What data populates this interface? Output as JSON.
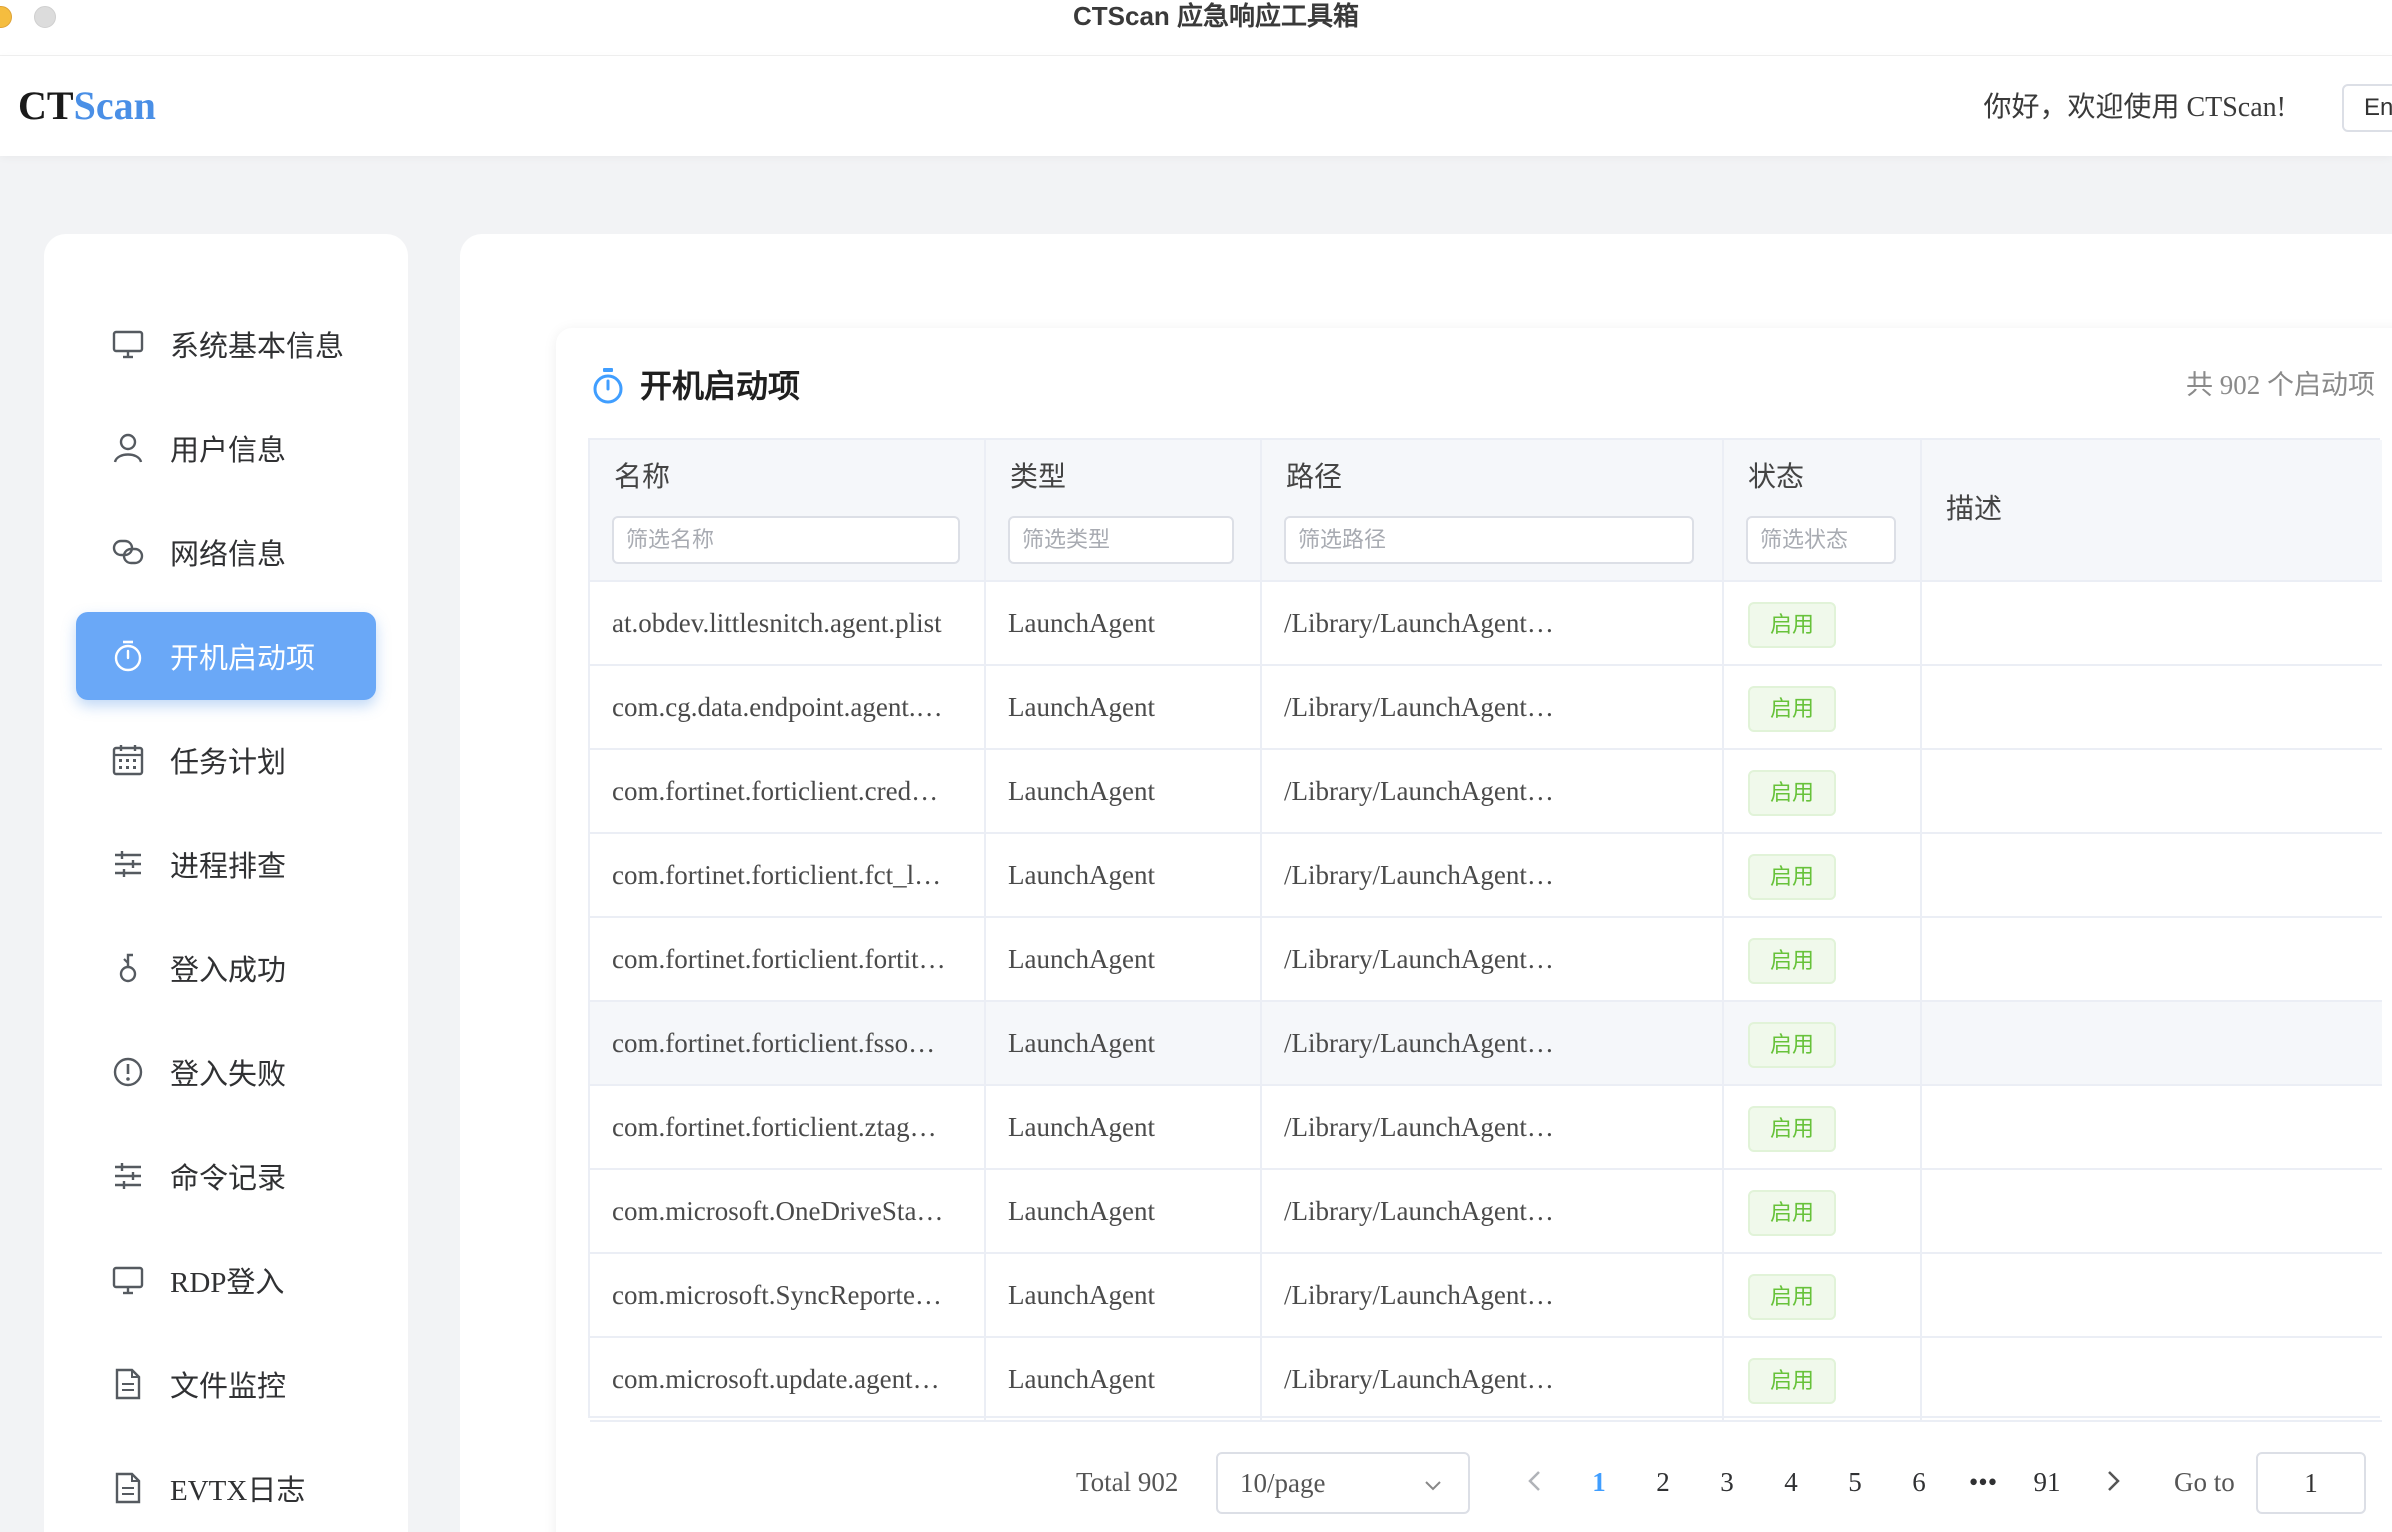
{
  "window": {
    "title": "CTScan 应急响应工具箱"
  },
  "header": {
    "logo_ct": "CT",
    "logo_scan": "Scan",
    "greeting": "你好，欢迎使用 CTScan!",
    "lang_button": "En"
  },
  "sidebar": {
    "items": [
      {
        "label": "系统基本信息",
        "icon": "monitor-icon"
      },
      {
        "label": "用户信息",
        "icon": "user-icon"
      },
      {
        "label": "网络信息",
        "icon": "link-icon"
      },
      {
        "label": "开机启动项",
        "icon": "timer-icon",
        "active": true
      },
      {
        "label": "任务计划",
        "icon": "calendar-icon"
      },
      {
        "label": "进程排查",
        "icon": "sliders-icon"
      },
      {
        "label": "登入成功",
        "icon": "key-icon"
      },
      {
        "label": "登入失败",
        "icon": "warning-icon"
      },
      {
        "label": "命令记录",
        "icon": "sliders-icon"
      },
      {
        "label": "RDP登入",
        "icon": "monitor-icon"
      },
      {
        "label": "文件监控",
        "icon": "document-icon"
      },
      {
        "label": "EVTX日志",
        "icon": "document-icon"
      }
    ]
  },
  "card": {
    "title": "开机启动项",
    "count": "共 902 个启动项",
    "accent_color": "#409eff"
  },
  "table": {
    "columns": [
      {
        "label": "名称",
        "filter_placeholder": "筛选名称"
      },
      {
        "label": "类型",
        "filter_placeholder": "筛选类型"
      },
      {
        "label": "路径",
        "filter_placeholder": "筛选路径"
      },
      {
        "label": "状态",
        "filter_placeholder": "筛选状态"
      },
      {
        "label": "描述"
      }
    ],
    "rows": [
      {
        "name": "at.obdev.littlesnitch.agent.plist",
        "type": "LaunchAgent",
        "path": "/Library/LaunchAgent…",
        "status": "启用",
        "desc": ""
      },
      {
        "name": "com.cg.data.endpoint.agent.…",
        "type": "LaunchAgent",
        "path": "/Library/LaunchAgent…",
        "status": "启用",
        "desc": ""
      },
      {
        "name": "com.fortinet.forticlient.cred…",
        "type": "LaunchAgent",
        "path": "/Library/LaunchAgent…",
        "status": "启用",
        "desc": ""
      },
      {
        "name": "com.fortinet.forticlient.fct_l…",
        "type": "LaunchAgent",
        "path": "/Library/LaunchAgent…",
        "status": "启用",
        "desc": ""
      },
      {
        "name": "com.fortinet.forticlient.fortit…",
        "type": "LaunchAgent",
        "path": "/Library/LaunchAgent…",
        "status": "启用",
        "desc": ""
      },
      {
        "name": "com.fortinet.forticlient.fsso…",
        "type": "LaunchAgent",
        "path": "/Library/LaunchAgent…",
        "status": "启用",
        "desc": "",
        "hover": true
      },
      {
        "name": "com.fortinet.forticlient.ztag…",
        "type": "LaunchAgent",
        "path": "/Library/LaunchAgent…",
        "status": "启用",
        "desc": ""
      },
      {
        "name": "com.microsoft.OneDriveSta…",
        "type": "LaunchAgent",
        "path": "/Library/LaunchAgent…",
        "status": "启用",
        "desc": ""
      },
      {
        "name": "com.microsoft.SyncReporte…",
        "type": "LaunchAgent",
        "path": "/Library/LaunchAgent…",
        "status": "启用",
        "desc": ""
      },
      {
        "name": "com.microsoft.update.agent…",
        "type": "LaunchAgent",
        "path": "/Library/LaunchAgent…",
        "status": "启用",
        "desc": ""
      }
    ]
  },
  "pagination": {
    "total": "Total 902",
    "page_size": "10/page",
    "pages": [
      "1",
      "2",
      "3",
      "4",
      "5",
      "6",
      "•••",
      "91"
    ],
    "current": "1",
    "goto_label": "Go to",
    "goto_value": "1"
  }
}
